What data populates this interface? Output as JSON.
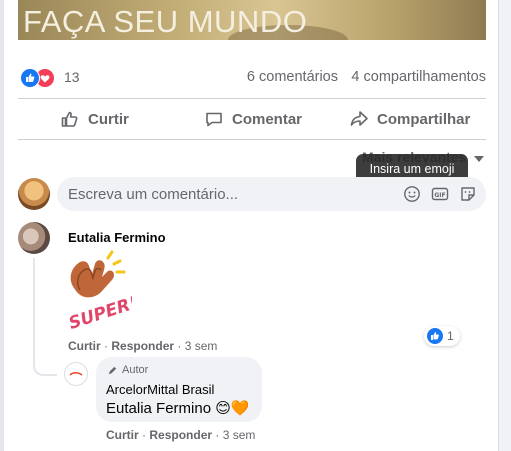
{
  "banner": {
    "text": "FAÇA SEU MUNDO"
  },
  "stats": {
    "reaction_count": "13",
    "comments": "6 comentários",
    "shares": "4 compartilhamentos"
  },
  "actions": {
    "like": "Curtir",
    "comment": "Comentar",
    "share": "Compartilhar"
  },
  "sort": {
    "label": "Mais relevantes"
  },
  "tooltip": {
    "text": "Insira um emoji"
  },
  "composer": {
    "placeholder": "Escreva um comentário..."
  },
  "comment": {
    "author": "Eutalia Fermino",
    "sticker_text": "SUPER!",
    "like_action": "Curtir",
    "reply_action": "Responder",
    "time": "· 3 sem",
    "separator": "·",
    "reaction_count": "1"
  },
  "reply": {
    "badge": "Autor",
    "author": "ArcelorMittal Brasil",
    "text": "Eutalia Fermino",
    "emojis": "😊🧡",
    "like_action": "Curtir",
    "reply_action": "Responder",
    "time": "· 3 sem",
    "separator": "·"
  },
  "colors": {
    "accent": "#1877f2",
    "love": "#f33e58",
    "muted_text": "#65676b",
    "bubble": "#f0f2f5"
  }
}
